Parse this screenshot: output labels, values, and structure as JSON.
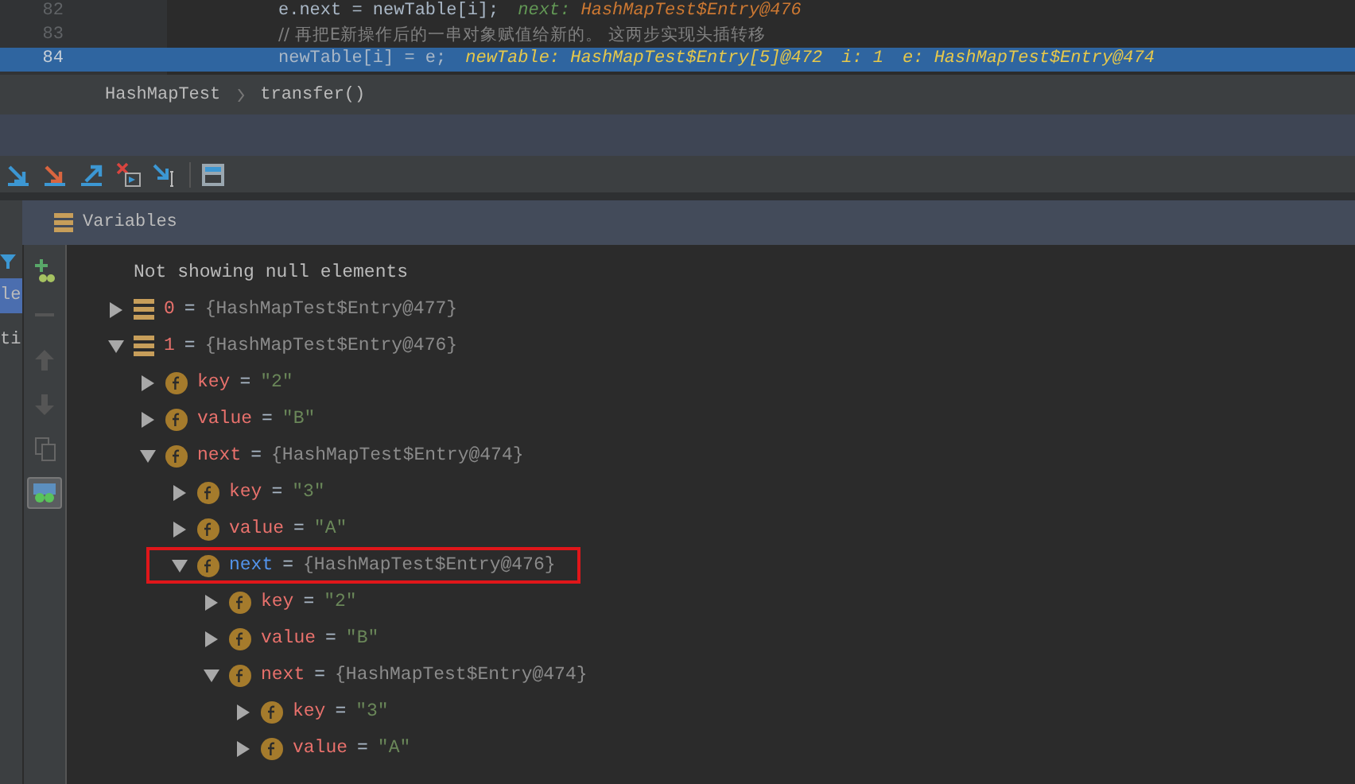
{
  "editor": {
    "lines": [
      {
        "number": "82",
        "selected": false,
        "code": "e.next = newTable[i];",
        "hints": [
          {
            "name": "next:",
            "value": "HashMapTest$Entry@476"
          }
        ]
      },
      {
        "number": "83",
        "selected": false,
        "comment": "// 再把E新操作后的一串对象赋值给新的。 这两步实现头插转移"
      },
      {
        "number": "84",
        "selected": true,
        "code": "newTable[i] = e;",
        "hints": [
          {
            "name": "newTable:",
            "value": "HashMapTest$Entry[5]@472"
          },
          {
            "name": "i:",
            "value": "1"
          },
          {
            "name": "e:",
            "value": "HashMapTest$Entry@474"
          }
        ]
      }
    ]
  },
  "breadcrumb": [
    "HashMapTest",
    "transfer()"
  ],
  "debug_toolbar": [
    {
      "kind": "step-over"
    },
    {
      "kind": "step-into"
    },
    {
      "kind": "step-out"
    },
    {
      "kind": "drop-frame"
    },
    {
      "kind": "run-to-cursor"
    },
    {
      "kind": "evaluate"
    }
  ],
  "left_panel": [
    {
      "text": "le",
      "selected": true
    },
    {
      "text": "ti",
      "selected": false
    }
  ],
  "variables": {
    "title": "Variables",
    "note": "Not showing null elements",
    "tree": [
      {
        "kind": "element",
        "name": "0",
        "op": "=",
        "value": {
          "kind": "object",
          "text": "{HashMapTest$Entry@477}"
        },
        "expanded": false,
        "highlighted": false
      },
      {
        "kind": "element",
        "name": "1",
        "op": "=",
        "value": {
          "kind": "object",
          "text": "{HashMapTest$Entry@476}"
        },
        "expanded": true,
        "highlighted": false,
        "children": [
          {
            "kind": "field",
            "name": "key",
            "op": "=",
            "value": {
              "kind": "string",
              "text": "\"2\""
            },
            "expanded": false,
            "highlighted": false
          },
          {
            "kind": "field",
            "name": "value",
            "op": "=",
            "value": {
              "kind": "string",
              "text": "\"B\""
            },
            "expanded": false,
            "highlighted": false
          },
          {
            "kind": "field",
            "name": "next",
            "op": "=",
            "value": {
              "kind": "object",
              "text": "{HashMapTest$Entry@474}"
            },
            "expanded": true,
            "highlighted": false,
            "children": [
              {
                "kind": "field",
                "name": "key",
                "op": "=",
                "value": {
                  "kind": "string",
                  "text": "\"3\""
                },
                "expanded": false,
                "highlighted": false
              },
              {
                "kind": "field",
                "name": "value",
                "op": "=",
                "value": {
                  "kind": "string",
                  "text": "\"A\""
                },
                "expanded": false,
                "highlighted": false
              },
              {
                "kind": "field",
                "name": "next",
                "op": "=",
                "value": {
                  "kind": "object",
                  "text": "{HashMapTest$Entry@476}"
                },
                "expanded": true,
                "highlighted": true,
                "children": [
                  {
                    "kind": "field",
                    "name": "key",
                    "op": "=",
                    "value": {
                      "kind": "string",
                      "text": "\"2\""
                    },
                    "expanded": false,
                    "highlighted": false
                  },
                  {
                    "kind": "field",
                    "name": "value",
                    "op": "=",
                    "value": {
                      "kind": "string",
                      "text": "\"B\""
                    },
                    "expanded": false,
                    "highlighted": false
                  },
                  {
                    "kind": "field",
                    "name": "next",
                    "op": "=",
                    "value": {
                      "kind": "object",
                      "text": "{HashMapTest$Entry@474}"
                    },
                    "expanded": true,
                    "highlighted": false,
                    "children": [
                      {
                        "kind": "field",
                        "name": "key",
                        "op": "=",
                        "value": {
                          "kind": "string",
                          "text": "\"3\""
                        },
                        "expanded": false,
                        "highlighted": false
                      },
                      {
                        "kind": "field",
                        "name": "value",
                        "op": "=",
                        "value": {
                          "kind": "string",
                          "text": "\"A\""
                        },
                        "expanded": false,
                        "highlighted": false
                      }
                    ]
                  }
                ]
              }
            ]
          }
        ]
      }
    ]
  }
}
